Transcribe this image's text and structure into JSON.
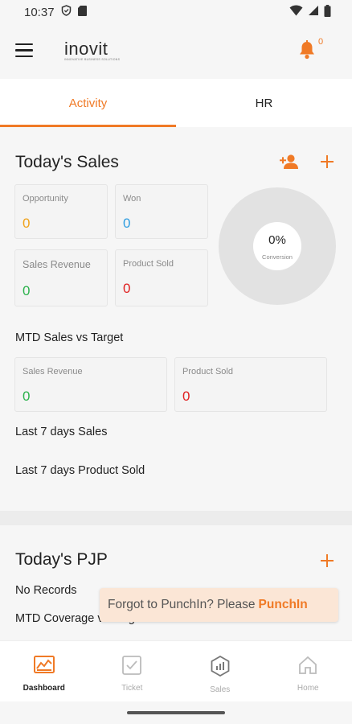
{
  "status_bar": {
    "time": "10:37"
  },
  "header": {
    "logo_text": "inovit",
    "logo_tagline": "INNOVATIVE BUSINESS SOLUTIONS",
    "notification_count": "0"
  },
  "tabs": [
    {
      "label": "Activity",
      "active": true
    },
    {
      "label": "HR",
      "active": false
    }
  ],
  "todays_sales": {
    "title": "Today's Sales",
    "opportunity": {
      "label": "Opportunity",
      "value": "0"
    },
    "won": {
      "label": "Won",
      "value": "0"
    },
    "sales_revenue": {
      "label": "Sales Revenue",
      "value": "0"
    },
    "product_sold": {
      "label": "Product Sold",
      "value": "0"
    },
    "conversion": {
      "value": "0%",
      "label": "Conversion"
    },
    "mtd_title": "MTD Sales vs Target",
    "mtd_sales_revenue": {
      "label": "Sales Revenue",
      "value": "0"
    },
    "mtd_product_sold": {
      "label": "Product Sold",
      "value": "0"
    },
    "last7_sales": "Last 7 days Sales",
    "last7_product": "Last 7 days Product Sold"
  },
  "todays_pjp": {
    "title": "Today's PJP",
    "no_records": "No Records",
    "mtd_coverage": "MTD Coverage vs Target"
  },
  "toast": {
    "message": "Forgot to PunchIn? Please",
    "action": "PunchIn"
  },
  "bottom_nav": [
    {
      "label": "Dashboard",
      "icon": "dashboard-icon",
      "active": true
    },
    {
      "label": "Ticket",
      "icon": "ticket-icon",
      "active": false
    },
    {
      "label": "Sales",
      "icon": "sales-icon",
      "active": false
    },
    {
      "label": "Home",
      "icon": "home-icon",
      "active": false
    }
  ],
  "colors": {
    "accent": "#f07a26",
    "opportunity": "#f0a21a",
    "won": "#2e9de0",
    "revenue": "#2bb24c",
    "product": "#e02020"
  }
}
